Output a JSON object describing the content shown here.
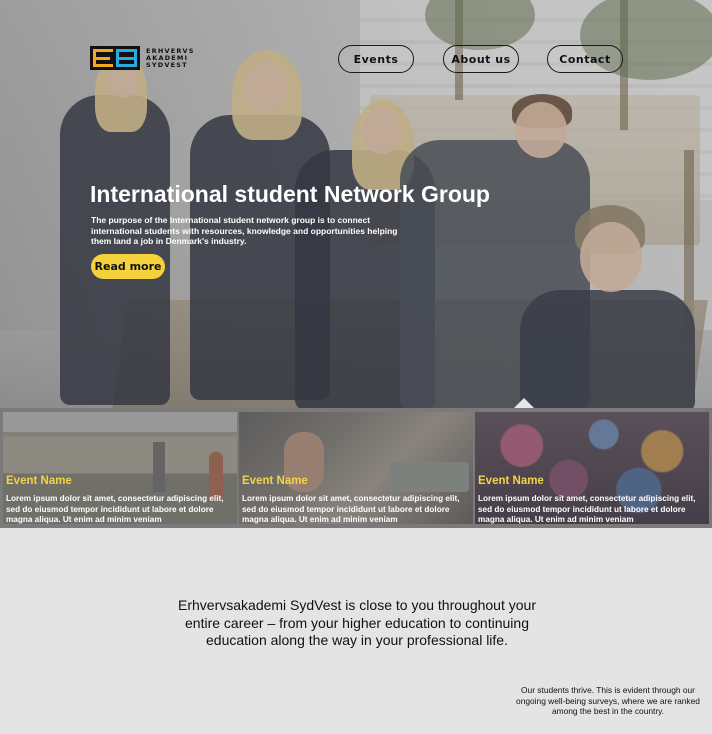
{
  "logo": {
    "lines": [
      "ERHVERVS",
      "AKADEMI",
      "SYDVEST"
    ]
  },
  "nav": {
    "items": [
      "Events",
      "About us",
      "Contact"
    ]
  },
  "hero": {
    "title": "International student Network Group",
    "description": "The purpose of the International student network group is to connect international students with resources, knowledge and opportunities helping them land a job in Denmark's industry.",
    "cta_label": "Read more"
  },
  "events": [
    {
      "name": "Event Name",
      "description": "Lorem ipsum dolor sit amet, consectetur adipiscing elit, sed do eiusmod tempor incididunt ut labore et dolore magna aliqua. Ut enim ad minim veniam"
    },
    {
      "name": "Event Name",
      "description": "Lorem ipsum dolor sit amet, consectetur adipiscing elit, sed do eiusmod tempor incididunt ut labore et dolore magna aliqua. Ut enim ad minim veniam"
    },
    {
      "name": "Event Name",
      "description": "Lorem ipsum dolor sit amet, consectetur adipiscing elit, sed do eiusmod tempor incididunt ut labore et dolore magna aliqua. Ut enim ad minim veniam"
    }
  ],
  "about": {
    "tagline": "Erhvervsakademi SydVest is close to you throughout your entire career – from your higher education to continuing education along the way in your professional life.",
    "thrive": "Our students thrive. This is evident through our ongoing well-being surveys, where we are ranked among the best in the country."
  },
  "colors": {
    "accent_yellow": "#f4d23b",
    "event_title": "#f3d34a",
    "logo_orange": "#f5a623",
    "logo_blue": "#2aa8e0",
    "page_bg": "#e4e4e4"
  }
}
